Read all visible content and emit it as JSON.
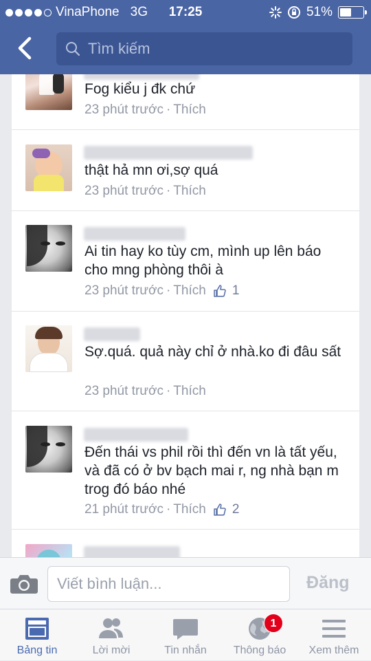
{
  "status_bar": {
    "carrier": "VinaPhone",
    "network": "3G",
    "time": "17:25",
    "battery": "51%",
    "battery_level": 0.51,
    "signal_bars_filled": 4,
    "signal_bars_total": 5
  },
  "header": {
    "back_icon": "chevron-left-icon",
    "search_placeholder": "Tìm kiếm"
  },
  "comments": [
    {
      "text": "Fog kiểu j đk chứ",
      "time": "23 phút trước",
      "like_label": "Thích",
      "likes": ""
    },
    {
      "text": "thật hả mn ơi,sợ quá",
      "time": "23 phút trước",
      "like_label": "Thích",
      "likes": ""
    },
    {
      "text": "Ai tin hay ko tùy cm, mình up lên báo cho mng phòng thôi à",
      "time": "23 phút trước",
      "like_label": "Thích",
      "likes": "1"
    },
    {
      "text": "Sợ.quá. quả này chỉ ở nhà.ko đi đâu sất",
      "time": "23 phút trước",
      "like_label": "Thích",
      "likes": ""
    },
    {
      "text": "Đến thái vs phil rồi thì đến vn là tất yếu, và đã có ở bv bạch mai r, ng nhà bạn m trog đó báo nhé",
      "time": "21 phút trước",
      "like_label": "Thích",
      "likes": "2"
    }
  ],
  "composer": {
    "camera_icon": "camera-icon",
    "placeholder": "Viết bình luận...",
    "post_label": "Đăng"
  },
  "tabs": [
    {
      "label": "Bảng tin",
      "icon": "news-feed-icon",
      "active": true
    },
    {
      "label": "Lời mời",
      "icon": "friends-icon"
    },
    {
      "label": "Tin nhắn",
      "icon": "chat-bubble-icon"
    },
    {
      "label": "Thông báo",
      "icon": "globe-icon",
      "badge": "1"
    },
    {
      "label": "Xem thêm",
      "icon": "menu-icon"
    }
  ],
  "colors": {
    "header": "#4a65a4",
    "accent": "#4a6ab0",
    "badge": "#e3001b"
  }
}
